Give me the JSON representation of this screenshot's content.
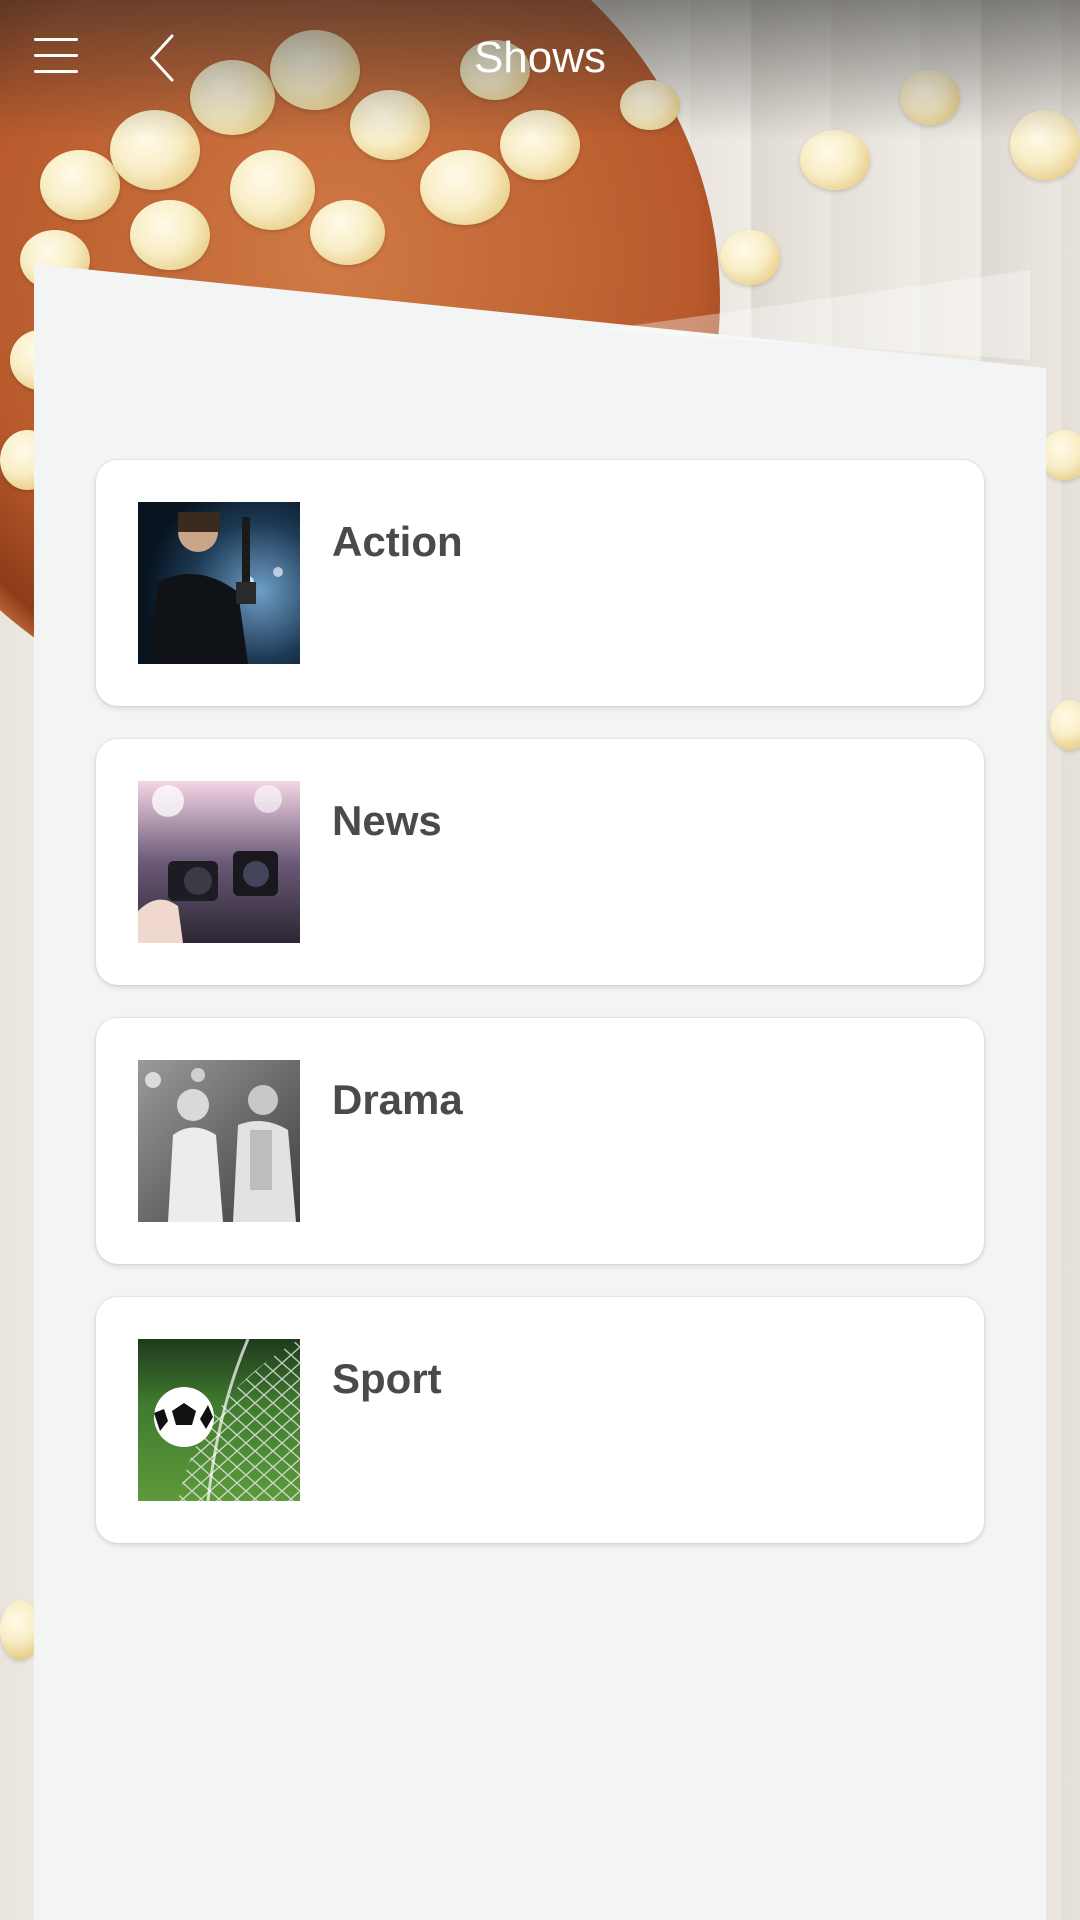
{
  "header": {
    "title": "Shows",
    "menu_icon": "hamburger-menu-icon",
    "back_icon": "chevron-left-icon"
  },
  "categories": [
    {
      "label": "Action",
      "thumbnail": "action-thumbnail"
    },
    {
      "label": "News",
      "thumbnail": "news-thumbnail"
    },
    {
      "label": "Drama",
      "thumbnail": "drama-thumbnail"
    },
    {
      "label": "Sport",
      "thumbnail": "sport-thumbnail"
    }
  ],
  "colors": {
    "panel": "#f3f5f4",
    "card": "#ffffff",
    "label_text": "#4a4a4a",
    "header_text": "#ffffff"
  }
}
